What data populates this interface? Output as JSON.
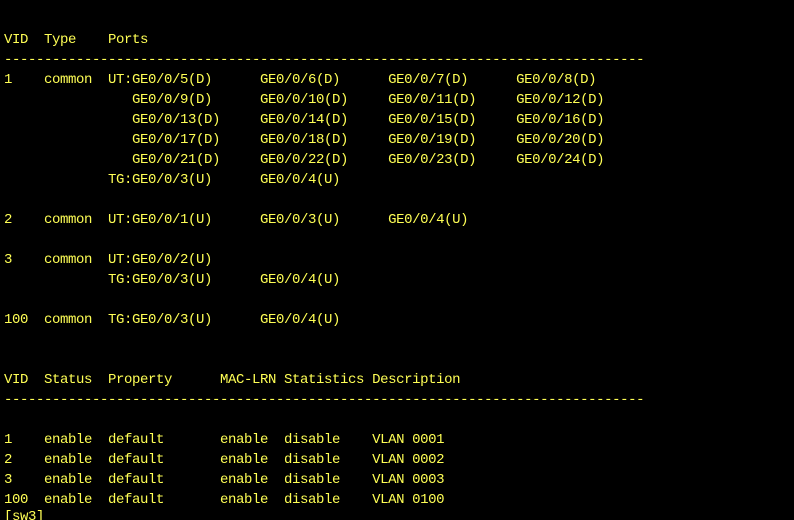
{
  "colors": {
    "background": "#000000",
    "text": "#ffff55"
  },
  "terminal": {
    "lines": [
      "--------------------------------------------------------------------------------",
      "",
      "VID  Type    Ports",
      "--------------------------------------------------------------------------------",
      "1    common  UT:GE0/0/5(D)      GE0/0/6(D)      GE0/0/7(D)      GE0/0/8(D)",
      "                GE0/0/9(D)      GE0/0/10(D)     GE0/0/11(D)     GE0/0/12(D)",
      "                GE0/0/13(D)     GE0/0/14(D)     GE0/0/15(D)     GE0/0/16(D)",
      "                GE0/0/17(D)     GE0/0/18(D)     GE0/0/19(D)     GE0/0/20(D)",
      "                GE0/0/21(D)     GE0/0/22(D)     GE0/0/23(D)     GE0/0/24(D)",
      "             TG:GE0/0/3(U)      GE0/0/4(U)",
      "",
      "2    common  UT:GE0/0/1(U)      GE0/0/3(U)      GE0/0/4(U)",
      "",
      "3    common  UT:GE0/0/2(U)",
      "             TG:GE0/0/3(U)      GE0/0/4(U)",
      "",
      "100  common  TG:GE0/0/3(U)      GE0/0/4(U)",
      "",
      "",
      "VID  Status  Property      MAC-LRN Statistics Description",
      "--------------------------------------------------------------------------------",
      "",
      "1    enable  default       enable  disable    VLAN 0001",
      "2    enable  default       enable  disable    VLAN 0002",
      "3    enable  default       enable  disable    VLAN 0003",
      "100  enable  default       enable  disable    VLAN 0100",
      "[sw3]"
    ]
  }
}
